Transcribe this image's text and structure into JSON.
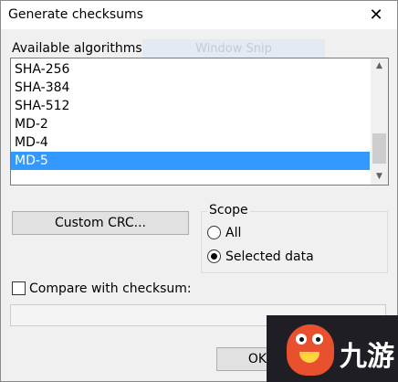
{
  "window": {
    "title": "Generate checksums",
    "close_glyph": "✕"
  },
  "algorithms": {
    "label": "Available algorithms:",
    "ghost_overlay_text": "Window Snip",
    "items": [
      {
        "label": "SHA-256",
        "selected": false
      },
      {
        "label": "SHA-384",
        "selected": false
      },
      {
        "label": "SHA-512",
        "selected": false
      },
      {
        "label": "MD-2",
        "selected": false
      },
      {
        "label": "MD-4",
        "selected": false
      },
      {
        "label": "MD-5",
        "selected": true
      }
    ],
    "scroll_up_glyph": "▲",
    "scroll_down_glyph": "▼"
  },
  "buttons": {
    "custom_crc": "Custom CRC...",
    "ok": "OK"
  },
  "scope": {
    "legend": "Scope",
    "options": [
      {
        "label": "All",
        "checked": false
      },
      {
        "label": "Selected data",
        "checked": true
      }
    ]
  },
  "compare": {
    "label": "Compare with checksum:",
    "checked": false,
    "value": ""
  },
  "watermark": {
    "text": "九游"
  },
  "colors": {
    "selection": "#3399ff",
    "watermark_bg": "#1e1e24",
    "mascot": "#e8502e"
  }
}
